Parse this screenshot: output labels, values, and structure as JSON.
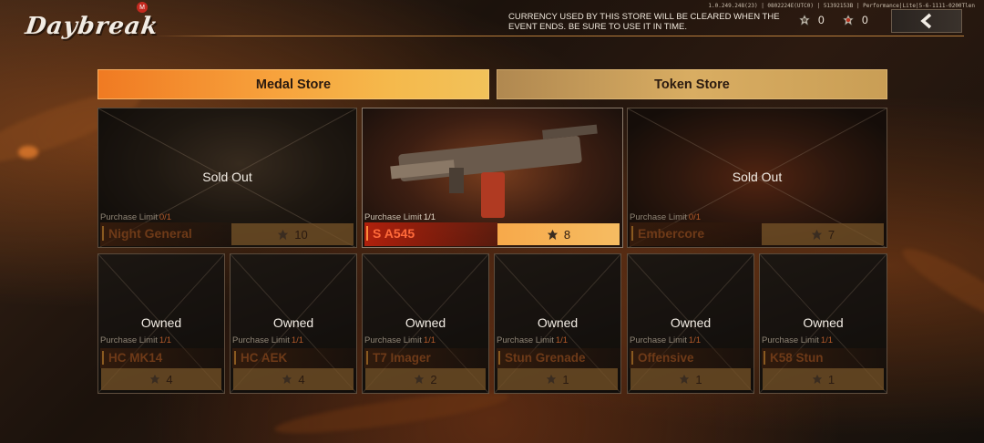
{
  "header": {
    "logo_text": "Daybreak",
    "logo_badge": "M",
    "build_info": "1.0.249.248(23) | 0802224E(UTC0) | 51392153B | Performance|Lite|5-6-1111-0200Tlen",
    "notice": "CURRENCY USED BY THIS STORE WILL BE CLEARED WHEN THE EVENT ENDS. BE SURE TO USE IT IN TIME.",
    "currencies": [
      {
        "icon": "medal-icon",
        "value": "0"
      },
      {
        "icon": "token-icon",
        "value": "0"
      }
    ],
    "back_icon": "chevron-left-icon"
  },
  "tabs": [
    {
      "label": "Medal Store",
      "active": true
    },
    {
      "label": "Token Store",
      "active": false
    }
  ],
  "featured_items": [
    {
      "name": "Night General",
      "status": "Sold Out",
      "limit_label": "Purchase Limit",
      "limit_value": "0/1",
      "price": "10"
    },
    {
      "name": "S A545",
      "status": "",
      "limit_label": "Purchase Limit",
      "limit_value": "1/1",
      "price": "8"
    },
    {
      "name": "Embercore",
      "status": "Sold Out",
      "limit_label": "Purchase Limit",
      "limit_value": "0/1",
      "price": "7"
    }
  ],
  "items": [
    {
      "name": "HC MK14",
      "status": "Owned",
      "limit_label": "Purchase Limit",
      "limit_value": "1/1",
      "price": "4"
    },
    {
      "name": "HC AEK",
      "status": "Owned",
      "limit_label": "Purchase Limit",
      "limit_value": "1/1",
      "price": "4"
    },
    {
      "name": "T7 Imager",
      "status": "Owned",
      "limit_label": "Purchase Limit",
      "limit_value": "1/1",
      "price": "2"
    },
    {
      "name": "Stun Grenade",
      "status": "Owned",
      "limit_label": "Purchase Limit",
      "limit_value": "1/1",
      "price": "1"
    },
    {
      "name": "Offensive",
      "status": "Owned",
      "limit_label": "Purchase Limit",
      "limit_value": "1/1",
      "price": "1"
    },
    {
      "name": "K58 Stun",
      "status": "Owned",
      "limit_label": "Purchase Limit",
      "limit_value": "1/1",
      "price": "1"
    }
  ],
  "colors": {
    "accent_orange": "#f7a23c",
    "active_name": "#ff6a3a",
    "tab_token": "#d9ad62"
  }
}
